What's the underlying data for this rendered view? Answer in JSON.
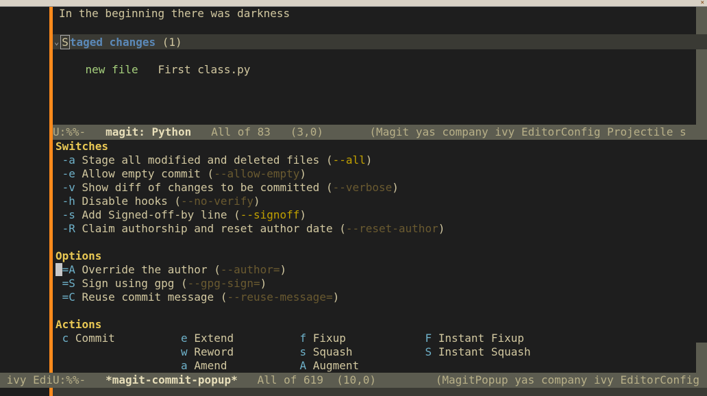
{
  "modeline_top": {
    "prefix": "U:%%-   ",
    "buffer": "magit: Python",
    "pos": "   All of 83   (3,0)       ",
    "modes": "(Magit yas company ivy EditorConfig Projectile s"
  },
  "modeline_bot": {
    "prefix": "U:%%-   ",
    "buffer": "*magit-commit-popup*",
    "pos": "   All of 619  (10,0)         ",
    "modes": "(MagitPopup yas company ivy EditorConfig "
  },
  "modeline_cut": " ivy Edi",
  "head": "In the beginning there was darkness",
  "staged": {
    "label": "taged changes",
    "count": "(1)"
  },
  "newfile": {
    "kw": "new file",
    "name": "   First class.py"
  },
  "switches_hdr": "Switches",
  "switches": [
    {
      "key": " -a ",
      "desc": "Stage all modified and deleted files (",
      "flag": "--all",
      "dim": false
    },
    {
      "key": " -e ",
      "desc": "Allow empty commit (",
      "flag": "--allow-empty",
      "dim": true
    },
    {
      "key": " -v ",
      "desc": "Show diff of changes to be committed (",
      "flag": "--verbose",
      "dim": true
    },
    {
      "key": " -h ",
      "desc": "Disable hooks (",
      "flag": "--no-verify",
      "dim": true
    },
    {
      "key": " -s ",
      "desc": "Add Signed-off-by line (",
      "flag": "--signoff",
      "dim": false
    },
    {
      "key": " -R ",
      "desc": "Claim authorship and reset author date (",
      "flag": "--reset-author",
      "dim": true
    }
  ],
  "options_hdr": "Options",
  "options": [
    {
      "key": "=A ",
      "desc": "Override the author (",
      "flag": "--author=",
      "dim": true,
      "cursor": true
    },
    {
      "key": " =S ",
      "desc": "Sign using gpg (",
      "flag": "--gpg-sign=",
      "dim": true,
      "cursor": false
    },
    {
      "key": " =C ",
      "desc": "Reuse commit message (",
      "flag": "--reuse-message=",
      "dim": true,
      "cursor": false
    }
  ],
  "actions_hdr": "Actions",
  "actions": {
    "row1": [
      {
        "key": " c ",
        "label": "Commit         "
      },
      {
        "key": " e ",
        "label": "Extend         "
      },
      {
        "key": " f ",
        "label": "Fixup           "
      },
      {
        "key": " F ",
        "label": "Instant Fixup"
      }
    ],
    "row2": [
      {
        "key": "   ",
        "label": "               "
      },
      {
        "key": " w ",
        "label": "Reword         "
      },
      {
        "key": " s ",
        "label": "Squash          "
      },
      {
        "key": " S ",
        "label": "Instant Squash"
      }
    ],
    "row3": [
      {
        "key": "   ",
        "label": "               "
      },
      {
        "key": " a ",
        "label": "Amend          "
      },
      {
        "key": " A ",
        "label": "Augment"
      }
    ]
  }
}
